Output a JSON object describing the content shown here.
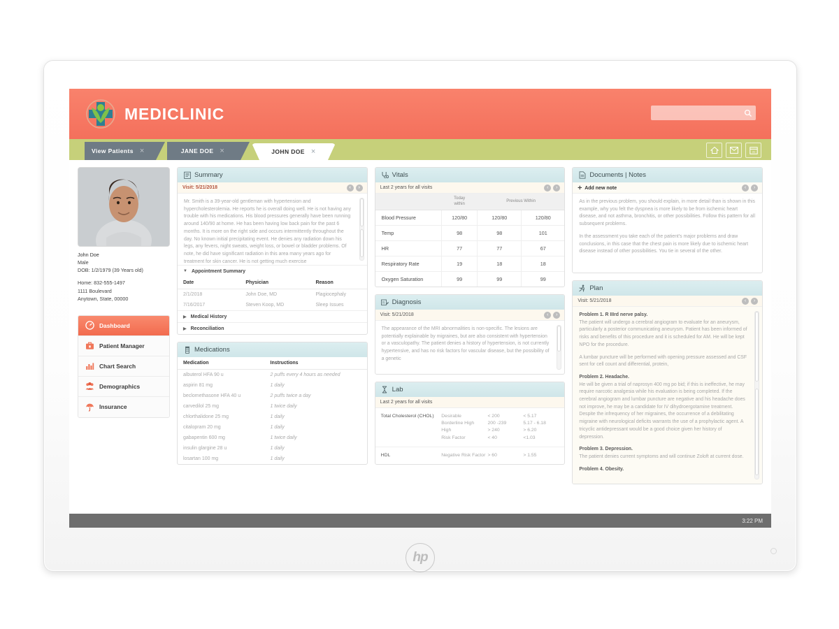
{
  "brand": {
    "name": "MEDICLINIC",
    "logo_icon": "medical-cross-figure-icon",
    "color": "#f4705c"
  },
  "search": {
    "placeholder": "",
    "value": "",
    "icon": "search-icon"
  },
  "tabs": [
    {
      "label": "View Patients",
      "active": false,
      "close": "×"
    },
    {
      "label": "JANE DOE",
      "active": false,
      "close": "×"
    },
    {
      "label": "JOHN DOE",
      "active": true,
      "close": "×"
    }
  ],
  "header_icons": [
    {
      "name": "home-icon",
      "glyph": "⌂"
    },
    {
      "name": "mail-icon",
      "glyph": "✉"
    },
    {
      "name": "calendar-icon",
      "glyph": "31"
    }
  ],
  "patient": {
    "name": "John Doe",
    "gender": "Male",
    "dob": "DOB: 1/2/1979 (39 Years old)",
    "phone": "Home: 832-555-1497",
    "address1": "1111 Boulevard",
    "address2": "Anytown, State, 00000",
    "photo_alt": "patient-photo"
  },
  "nav": [
    {
      "label": "Dashboard",
      "icon": "gauge-icon",
      "active": true
    },
    {
      "label": "Patient Manager",
      "icon": "briefcase-icon",
      "active": false
    },
    {
      "label": "Chart Search",
      "icon": "bar-chart-icon",
      "active": false
    },
    {
      "label": "Demographics",
      "icon": "people-icon",
      "active": false
    },
    {
      "label": "Insurance",
      "icon": "umbrella-icon",
      "active": false
    }
  ],
  "summary": {
    "title": "Summary",
    "icon": "clipboard-icon",
    "visit": "Visit: 5/21/2018",
    "text": "Mr. Smith is a 39-year-old gentleman with hypertension and hypercholesterolemia. He reports he is overall doing well. He is not having any trouble with his medications. His blood pressures generally have been running around 140/90 at home. He has been having low back pain for the past 6 months. It is more on the right side and occurs intermittently throughout the day. No known initial precipitating event. He denies any radiation down his legs, any fevers, night sweats, weight loss, or bowel or bladder problems. Of note, he did have significant radiation in this area many years ago for treatment for skin cancer. He is not getting much exercise",
    "accordion_appointments": "Appointment Summary",
    "appointment_headers": [
      "Date",
      "Physician",
      "Reason"
    ],
    "appointments": [
      [
        "2/1/2018",
        "John Doe, MD",
        "Plagiocephaly"
      ],
      [
        "7/16/2017",
        "Steven Koop, MD",
        "Sleep Issues"
      ]
    ],
    "accordion_history": "Medical History",
    "accordion_reconciliation": "Reconciliation"
  },
  "medications": {
    "title": "Medications",
    "icon": "pill-bottle-icon",
    "headers": [
      "Medication",
      "Instructions"
    ],
    "rows": [
      [
        "albuterol HFA 90 u",
        "2 puffs every 4 hours as needed"
      ],
      [
        "aspirin 81 mg",
        "1 daily"
      ],
      [
        "beclomethasone HFA 40 u",
        "2 puffs twice a day"
      ],
      [
        "carvedilol 25 mg",
        "1 twice daily"
      ],
      [
        "chlorthalidone 25 mg",
        "1 daily"
      ],
      [
        "citalopram 20 mg",
        "1 daily"
      ],
      [
        "gabapentin 600 mg",
        "1 twice daily"
      ],
      [
        "insulin glargine 28 u",
        "1 daily"
      ],
      [
        "losartan 100 mg",
        "1 daily"
      ]
    ]
  },
  "vitals": {
    "title": "Vitals",
    "icon": "stethoscope-icon",
    "subbar": "Last 2 years for all visits",
    "col_today": "Today\nwithin",
    "col_previous": "Previous Within",
    "rows": [
      {
        "label": "Blood Pressure",
        "today": "120/80",
        "prev1": "120/80",
        "prev2": "120/80"
      },
      {
        "label": "Temp",
        "today": "98",
        "prev1": "98",
        "prev2": "101"
      },
      {
        "label": "HR",
        "today": "77",
        "prev1": "77",
        "prev2": "67"
      },
      {
        "label": "Respiratory Rate",
        "today": "19",
        "prev1": "18",
        "prev2": "18"
      },
      {
        "label": "Oxygen Saturation",
        "today": "99",
        "prev1": "99",
        "prev2": "99"
      }
    ]
  },
  "diagnosis": {
    "title": "Diagnosis",
    "icon": "prescription-icon",
    "visit": "Visit: 5/21/2018",
    "text": "The appearance of the MRI abnormalities is non-specific. The lesions are potentially explainable by migraines, but are also consistent with hypertension or a vasculopathy. The patient denies a history of hypertension, is not currently hypertensive, and has no risk factors for vascular disease, but the possibility of a genetic"
  },
  "lab": {
    "title": "Lab",
    "icon": "lab-dna-icon",
    "subbar": "Last 2 years for all visits",
    "rows": [
      {
        "name": "Total Cholesterol (CHOL)",
        "categories": [
          "Desirable",
          "Borderline High",
          "High",
          "Risk Factor"
        ],
        "values1": [
          "< 200",
          "200 -239",
          "> 240",
          "< 40"
        ],
        "values2": [
          "< 5.17",
          "5.17 - 6.18",
          "> 6.20",
          "<1.03"
        ]
      },
      {
        "name": "HDL",
        "categories": [
          "Negative Risk Factor"
        ],
        "values1": [
          "> 60"
        ],
        "values2": [
          "> 1.55"
        ]
      }
    ]
  },
  "documents": {
    "title": "Documents | Notes",
    "icon": "document-icon",
    "add_note": "Add new note",
    "paragraph1": "As in the previous problem, you should explain, in more detail than is shown in this example, why you felt the dyspnea is more likely to be from ischemic heart disease, and not asthma, bronchitis, or other possibilities. Follow this pattern for all subsequent problems.",
    "paragraph2": "In the assessment you take each of the patient's major problems and draw conclusions, in this case that the chest pain is more likely due to ischemic heart disease instead of other possibilities. You tie in several of the other."
  },
  "plan": {
    "title": "Plan",
    "icon": "running-person-icon",
    "visit": "Visit: 5/21/2018",
    "problem1_title": "Problem 1. R IIIrd nerve palsy.",
    "problem1_text": "The patient will undergo a cerebral angiogram to evaluate for an aneurysm, particularly a posterior communicating aneurysm. Patient has been informed of risks and benefits of this procedure and it is scheduled for AM. He will be kept NPO for the procedure.",
    "problem1_text2": "A lumbar puncture will be performed with opening pressure assessed and CSF sent for cell count and differential, protein,",
    "problem2_title": "Problem 2. Headache.",
    "problem2_text": "He will be given a trial of naprosyn 400 mg po bid; if this is ineffective, he may require narcotic analgesia while his evaluation is being completed. If the cerebral angiogram and lumbar puncture are negative and his headache does not improve, he may be a candidate for IV dihydroergotamine treatment. Despite the infrequency of her migraines, the occurrence of a debilitating migraine with neurological deficits warrants the use of a prophylactic agent. A tricyclic antidepressant would be a good choice given her history of depression.",
    "problem3_title": "Problem 3. Depression.",
    "problem3_text": "The patient denies current symptoms and will continue Zoloft at current dose.",
    "problem4_title": "Problem 4. Obesity."
  },
  "statusbar": {
    "time": "3:22 PM"
  },
  "device": {
    "vendor": "hp"
  }
}
